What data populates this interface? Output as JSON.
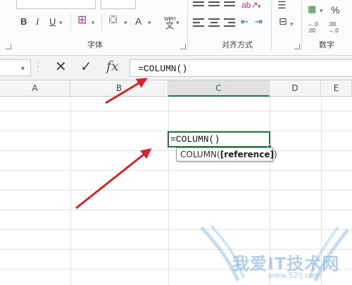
{
  "ribbon": {
    "font_buttons": [
      "B",
      "I",
      "U"
    ],
    "font_color_letter": "A",
    "phonetic_label": "wén",
    "group_font": "字体",
    "group_alignment": "对齐方式",
    "group_number": "数字",
    "percent": "%"
  },
  "formula_bar": {
    "name_box": "",
    "cancel_glyph": "✕",
    "enter_glyph": "✓",
    "fx_label": "fx",
    "formula": "=COLUMN()"
  },
  "sheet": {
    "columns": [
      "A",
      "B",
      "C",
      "D",
      "E"
    ],
    "selected_column": "C",
    "active_cell_content": "=COLUMN()",
    "tooltip": {
      "function_name": "COLUMN(",
      "argument": "[reference]",
      "close": ")"
    }
  },
  "watermark": {
    "text": "我爱IT技术网",
    "url": "www.52ij.com"
  },
  "colors": {
    "accent": "#217346",
    "arrow": "#d9232a"
  }
}
